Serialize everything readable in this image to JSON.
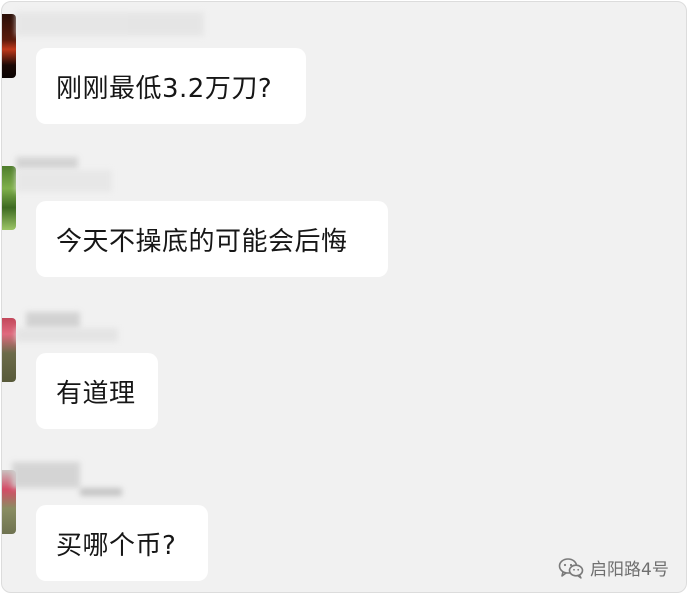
{
  "messages": [
    {
      "text": "刚刚最低3.2万刀?"
    },
    {
      "text": "今天不操底的可能会后悔"
    },
    {
      "text": "有道理"
    },
    {
      "text": "买哪个币?"
    }
  ],
  "watermark": {
    "icon": "wechat-icon",
    "text": "启阳路4号"
  }
}
